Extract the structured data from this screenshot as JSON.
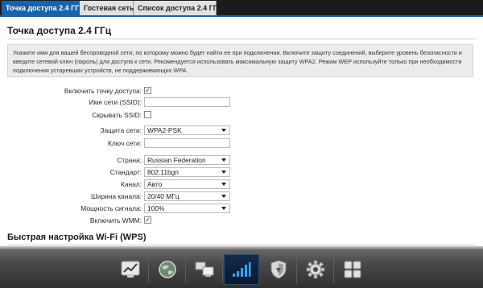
{
  "tabs": [
    {
      "label": "Точка доступа 2.4 ГГц",
      "active": true
    },
    {
      "label": "Гостевая сеть",
      "active": false
    },
    {
      "label": "Список доступа 2.4 ГГц",
      "active": false
    }
  ],
  "page": {
    "title": "Точка доступа 2.4 ГГц",
    "note": "Укажите имя для вашей беспроводной сети, по которому можно будет найти ее при подключении. Включите защиту соединений, выберите уровень безопасности и введите сетевой ключ (пароль) для доступа к сети. Рекомендуется использовать максимальную защиту WPA2. Режим WEP используйте только при необходимости подключения устаревших устройств, не поддерживающих WPA."
  },
  "form": {
    "enable_ap_label": "Включить точку доступа:",
    "enable_ap_checked": true,
    "ssid_label": "Имя сети (SSID):",
    "ssid_value": "",
    "hide_ssid_label": "Скрывать SSID:",
    "hide_ssid_checked": false,
    "security_label": "Защита сети:",
    "security_value": "WPA2-PSK",
    "key_label": "Ключ сети:",
    "key_value": "",
    "country_label": "Страна:",
    "country_value": "Russian Federation",
    "standard_label": "Стандарт:",
    "standard_value": "802.11bgn",
    "channel_label": "Канал:",
    "channel_value": "Авто",
    "width_label": "Ширина канала:",
    "width_value": "20/40 МГц",
    "power_label": "Мощность сигнала:",
    "power_value": "100%",
    "wmm_label": "Включить WMM:",
    "wmm_checked": true
  },
  "wps": {
    "title": "Быстрая настройка Wi-Fi (WPS)"
  },
  "dock": {
    "items": [
      {
        "icon": "chart-icon",
        "active": false
      },
      {
        "icon": "globe-icon",
        "active": false
      },
      {
        "icon": "network-icon",
        "active": false
      },
      {
        "icon": "wifi-signal-icon",
        "active": true
      },
      {
        "icon": "shield-icon",
        "active": false
      },
      {
        "icon": "gear-icon",
        "active": false
      },
      {
        "icon": "apps-icon",
        "active": false
      }
    ]
  },
  "colors": {
    "accent": "#1b62a8",
    "tab_bar": "#1b1b1b",
    "dock": "#4a4a4a"
  }
}
